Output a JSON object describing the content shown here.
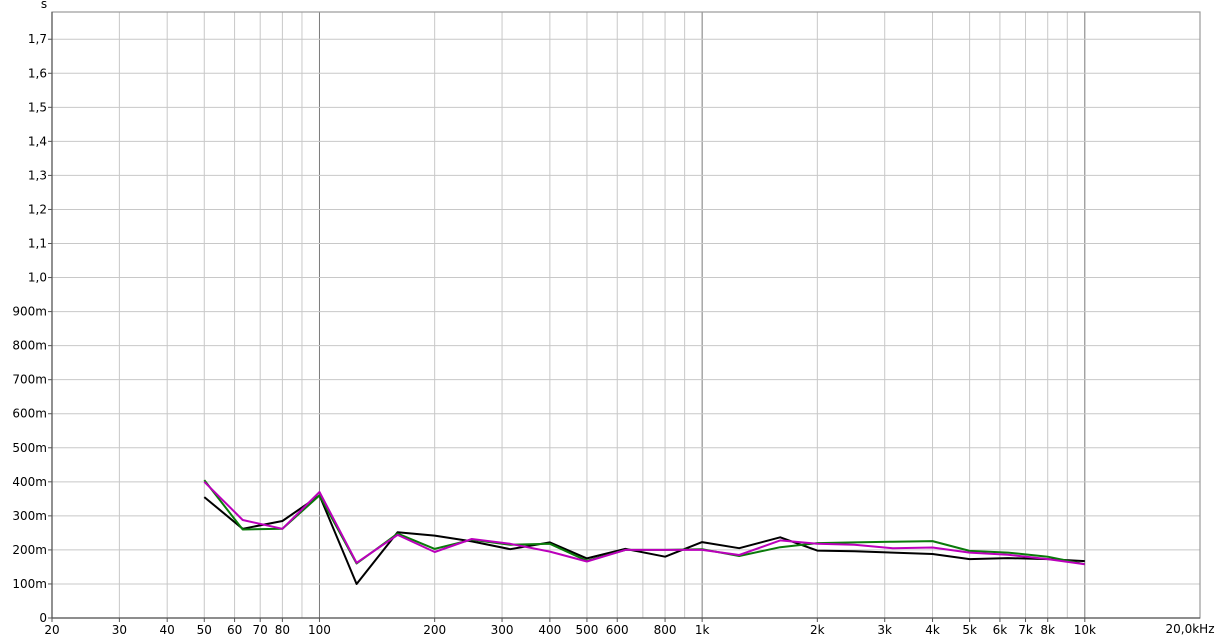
{
  "chart_data": {
    "type": "line",
    "xscale": "log",
    "xlim": [
      20,
      20000
    ],
    "ylim": [
      0,
      1.78
    ],
    "grid": true,
    "y_unit_label": "s",
    "x_unit_label": "20,0kHz",
    "x_ticks": [
      {
        "value": 20,
        "label": "20"
      },
      {
        "value": 30,
        "label": "30"
      },
      {
        "value": 40,
        "label": "40"
      },
      {
        "value": 50,
        "label": "50"
      },
      {
        "value": 60,
        "label": "60"
      },
      {
        "value": 70,
        "label": "70"
      },
      {
        "value": 80,
        "label": "80"
      },
      {
        "value": 100,
        "label": "100"
      },
      {
        "value": 200,
        "label": "200"
      },
      {
        "value": 300,
        "label": "300"
      },
      {
        "value": 400,
        "label": "400"
      },
      {
        "value": 500,
        "label": "500"
      },
      {
        "value": 600,
        "label": "600"
      },
      {
        "value": 800,
        "label": "800"
      },
      {
        "value": 1000,
        "label": "1k"
      },
      {
        "value": 2000,
        "label": "2k"
      },
      {
        "value": 3000,
        "label": "3k"
      },
      {
        "value": 4000,
        "label": "4k"
      },
      {
        "value": 5000,
        "label": "5k"
      },
      {
        "value": 6000,
        "label": "6k"
      },
      {
        "value": 7000,
        "label": "7k"
      },
      {
        "value": 8000,
        "label": "8k"
      },
      {
        "value": 10000,
        "label": "10k"
      }
    ],
    "x_gridlines": [
      20,
      30,
      40,
      50,
      60,
      70,
      80,
      90,
      100,
      200,
      300,
      400,
      500,
      600,
      700,
      800,
      900,
      1000,
      2000,
      3000,
      4000,
      5000,
      6000,
      7000,
      8000,
      9000,
      10000,
      20000
    ],
    "x_major_lines": [
      100,
      1000,
      10000
    ],
    "y_ticks": [
      {
        "value": 0,
        "label": "0"
      },
      {
        "value": 0.1,
        "label": "100m"
      },
      {
        "value": 0.2,
        "label": "200m"
      },
      {
        "value": 0.3,
        "label": "300m"
      },
      {
        "value": 0.4,
        "label": "400m"
      },
      {
        "value": 0.5,
        "label": "500m"
      },
      {
        "value": 0.6,
        "label": "600m"
      },
      {
        "value": 0.7,
        "label": "700m"
      },
      {
        "value": 0.8,
        "label": "800m"
      },
      {
        "value": 0.9,
        "label": "900m"
      },
      {
        "value": 1.0,
        "label": "1,0"
      },
      {
        "value": 1.1,
        "label": "1,1"
      },
      {
        "value": 1.2,
        "label": "1,2"
      },
      {
        "value": 1.3,
        "label": "1,3"
      },
      {
        "value": 1.4,
        "label": "1,4"
      },
      {
        "value": 1.5,
        "label": "1,5"
      },
      {
        "value": 1.6,
        "label": "1,6"
      },
      {
        "value": 1.7,
        "label": "1,7"
      }
    ],
    "x": [
      50,
      63,
      80,
      100,
      125,
      160,
      200,
      250,
      315,
      400,
      500,
      630,
      800,
      1000,
      1250,
      1600,
      2000,
      2500,
      3150,
      4000,
      5000,
      6300,
      8000,
      10000
    ],
    "series": [
      {
        "color": "#000000",
        "values": [
          0.355,
          0.262,
          0.285,
          0.36,
          0.1,
          0.252,
          0.242,
          0.225,
          0.202,
          0.222,
          0.175,
          0.203,
          0.18,
          0.223,
          0.205,
          0.237,
          0.198,
          0.196,
          0.192,
          0.188,
          0.173,
          0.176,
          0.173,
          0.167
        ]
      },
      {
        "color": "#0a7a0a",
        "values": [
          0.405,
          0.26,
          0.262,
          0.36,
          0.16,
          0.248,
          0.203,
          0.23,
          0.215,
          0.218,
          0.168,
          0.2,
          0.2,
          0.202,
          0.182,
          0.208,
          0.22,
          0.222,
          0.224,
          0.226,
          0.197,
          0.192,
          0.18,
          0.158
        ]
      },
      {
        "color": "#bb00bb",
        "values": [
          0.4,
          0.288,
          0.262,
          0.37,
          0.162,
          0.244,
          0.194,
          0.232,
          0.218,
          0.195,
          0.166,
          0.2,
          0.2,
          0.2,
          0.185,
          0.228,
          0.218,
          0.215,
          0.205,
          0.207,
          0.192,
          0.186,
          0.173,
          0.158
        ]
      }
    ]
  }
}
